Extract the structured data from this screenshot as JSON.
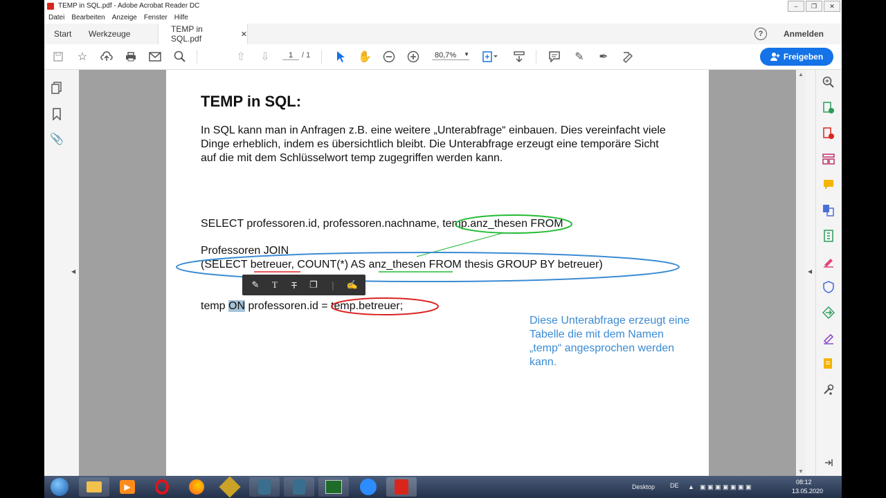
{
  "window": {
    "title": "TEMP in SQL.pdf - Adobe Acrobat Reader DC",
    "buttons": [
      "–",
      "❐",
      "✕"
    ]
  },
  "menu": [
    "Datei",
    "Bearbeiten",
    "Anzeige",
    "Fenster",
    "Hilfe"
  ],
  "tabs": {
    "start": "Start",
    "tools": "Werkzeuge",
    "document": "TEMP in SQL.pdf",
    "close": "✕"
  },
  "account": {
    "help": "?",
    "signin": "Anmelden"
  },
  "toolbar": {
    "page_current": "1",
    "page_total": "/ 1",
    "zoom": "80,7%",
    "share": "Freigeben"
  },
  "document": {
    "heading": "TEMP in SQL:",
    "paragraph": "In SQL kann man in Anfragen z.B. eine weitere „Unterabfrage“ einbauen. Dies vereinfacht viele Dinge erheblich, indem es übersichtlich bleibt. Die Unterabfrage erzeugt eine temporäre Sicht auf die mit dem Schlüsselwort temp zugegriffen werden kann.",
    "sql_line1": "SELECT professoren.id, professoren.nachname, temp.anz_thesen FROM",
    "sql_line2": "Professoren JOIN",
    "sql_line3": "(SELECT betreuer, COUNT(*) AS anz_thesen FROM thesis GROUP BY betreuer)",
    "sql_line4_a": "temp ",
    "sql_line4_on": "ON",
    "sql_line4_b": " professoren.id = temp.betreuer;",
    "note": "Diese Unterabfrage erzeugt eine Tabelle die mit dem Namen „temp“ angesprochen werden kann."
  },
  "colors": {
    "accent": "#1473e6",
    "annotation_green": "#22bb33",
    "annotation_blue": "#3a8bd4",
    "annotation_red": "#dd2222"
  },
  "taskbar": {
    "desktop": "Desktop",
    "lang": "DE",
    "time": "08:12",
    "date": "13.05.2020"
  }
}
